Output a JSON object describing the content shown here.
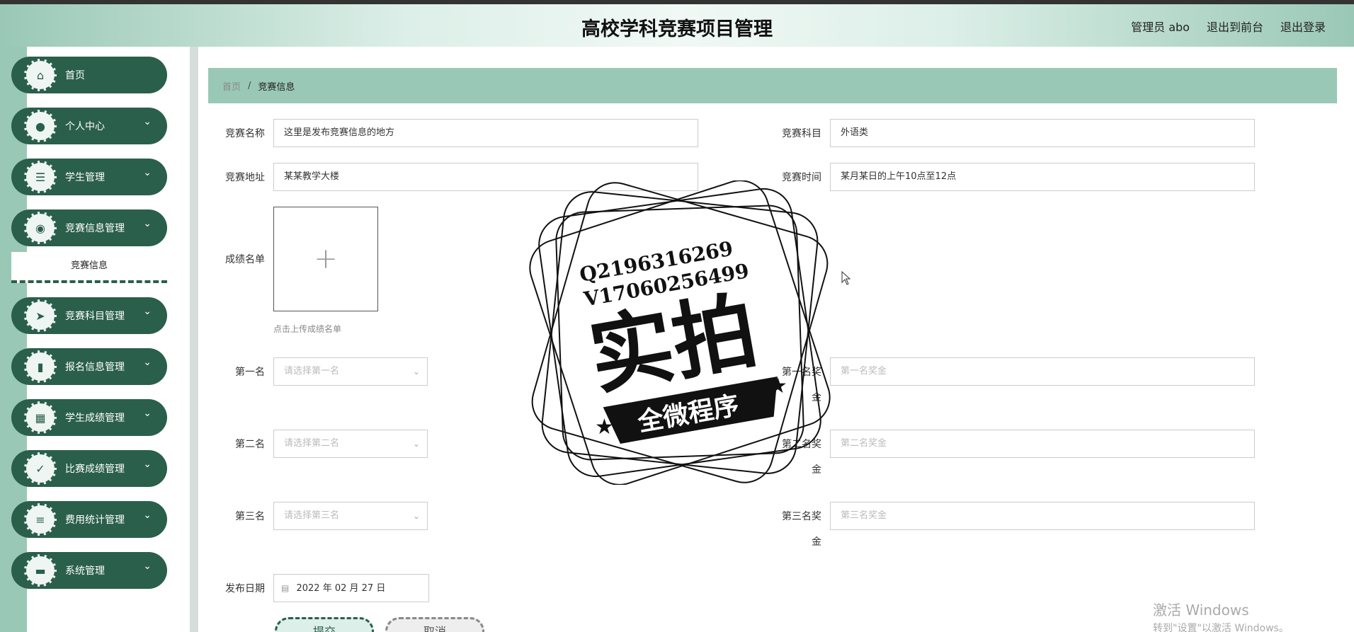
{
  "header": {
    "title": "高校学科竞赛项目管理",
    "user": "管理员 abo",
    "front_link": "退出到前台",
    "logout_link": "退出登录"
  },
  "sidebar": {
    "items": [
      {
        "label": "首页",
        "icon": "home-icon",
        "has_arrow": false
      },
      {
        "label": "个人中心",
        "icon": "user-icon",
        "has_arrow": true
      },
      {
        "label": "学生管理",
        "icon": "sliders-icon",
        "has_arrow": true
      },
      {
        "label": "竞赛信息管理",
        "icon": "pin-icon",
        "has_arrow": true,
        "submenu": "竞赛信息"
      },
      {
        "label": "竞赛科目管理",
        "icon": "send-icon",
        "has_arrow": true
      },
      {
        "label": "报名信息管理",
        "icon": "book-icon",
        "has_arrow": true
      },
      {
        "label": "学生成绩管理",
        "icon": "grid-icon",
        "has_arrow": true
      },
      {
        "label": "比赛成绩管理",
        "icon": "clipboard-icon",
        "has_arrow": true
      },
      {
        "label": "费用统计管理",
        "icon": "list-icon",
        "has_arrow": true
      },
      {
        "label": "系统管理",
        "icon": "ticket-icon",
        "has_arrow": true
      }
    ]
  },
  "breadcrumb": {
    "home": "首页",
    "separator": "/",
    "current": "竞赛信息"
  },
  "form": {
    "name_label": "竞赛名称",
    "name_value": "这里是发布竞赛信息的地方",
    "subject_label": "竞赛科目",
    "subject_value": "外语类",
    "address_label": "竞赛地址",
    "address_value": "某某教学大楼",
    "time_label": "竞赛时间",
    "time_value": "某月某日的上午10点至12点",
    "list_label": "成绩名单",
    "upload_hint": "点击上传成绩名单",
    "first_label": "第一名",
    "first_placeholder": "请选择第一名",
    "first_prize_label_1": "第一名奖",
    "first_prize_label_2": "金",
    "first_prize_placeholder": "第一名奖金",
    "second_label": "第二名",
    "second_placeholder": "请选择第二名",
    "second_prize_label_1": "第二名奖",
    "second_prize_label_2": "金",
    "second_prize_placeholder": "第二名奖金",
    "third_label": "第三名",
    "third_placeholder": "请选择第三名",
    "third_prize_label_1": "第三名奖",
    "third_prize_label_2": "金",
    "third_prize_placeholder": "第三名奖金",
    "date_label": "发布日期",
    "date_value": "2022 年 02 月 27 日",
    "submit_label": "提交",
    "cancel_label": "取消"
  },
  "watermark": {
    "line1": "Q2196316269",
    "line2": "V17060256499",
    "big": "实拍",
    "banner": "全微程序"
  },
  "windows_activation": {
    "line1": "激活 Windows",
    "line2": "转到\"设置\"以激活 Windows。"
  },
  "colors": {
    "primary": "#2a5f4b",
    "accent": "#9ac8b6"
  }
}
